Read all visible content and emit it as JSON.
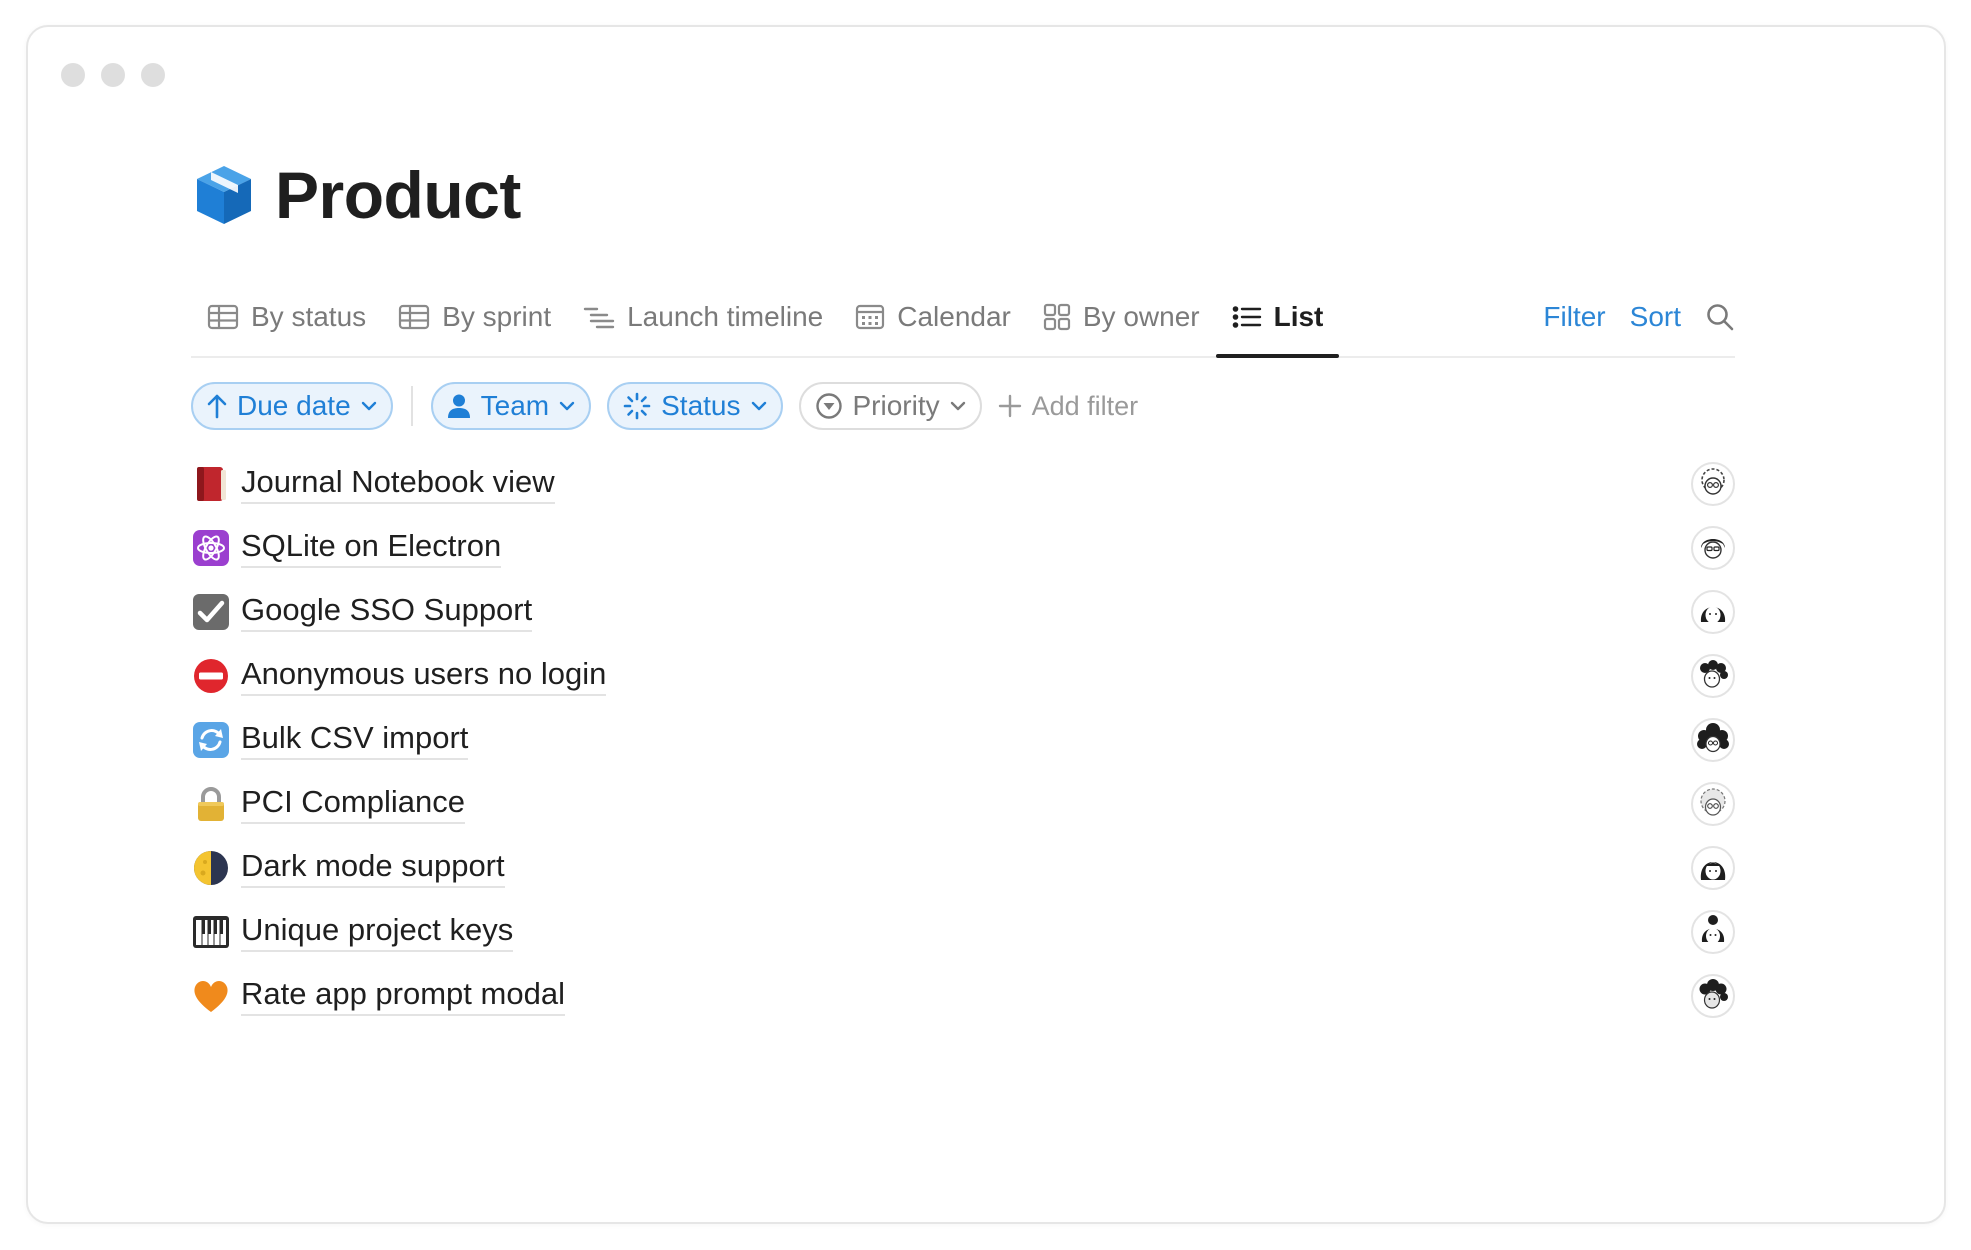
{
  "page": {
    "title": "Product",
    "icon": "package-cube-icon"
  },
  "tabs": [
    {
      "label": "By status",
      "icon": "table-icon",
      "active": false
    },
    {
      "label": "By sprint",
      "icon": "table-icon",
      "active": false
    },
    {
      "label": "Launch timeline",
      "icon": "timeline-icon",
      "active": false
    },
    {
      "label": "Calendar",
      "icon": "calendar-icon",
      "active": false
    },
    {
      "label": "By owner",
      "icon": "board-grid-icon",
      "active": false
    },
    {
      "label": "List",
      "icon": "list-icon",
      "active": true
    }
  ],
  "tab_actions": {
    "filter_label": "Filter",
    "sort_label": "Sort",
    "search_icon": "search-icon"
  },
  "filters": [
    {
      "label": "Due date",
      "icon": "arrow-up-icon",
      "active": true
    },
    {
      "label": "Team",
      "icon": "person-icon",
      "active": true
    },
    {
      "label": "Status",
      "icon": "status-spinner-icon",
      "active": true
    },
    {
      "label": "Priority",
      "icon": "priority-circle-icon",
      "active": false
    }
  ],
  "add_filter_label": "Add filter",
  "colors": {
    "accent_blue": "#2c86d6",
    "chip_border": "#a8cff2",
    "chip_bg": "#eaf3fc",
    "text_primary": "#1f1f1f",
    "text_muted": "#7a7a7a"
  },
  "items": [
    {
      "title": "Journal Notebook view",
      "icon": "red-book-icon",
      "owner_avatar": "avatar-glasses-curly"
    },
    {
      "title": "SQLite on Electron",
      "icon": "atom-symbol-icon",
      "owner_avatar": "avatar-dark-hair-glasses"
    },
    {
      "title": "Google SSO Support",
      "icon": "checkbox-checked-icon",
      "owner_avatar": "avatar-dark-hair"
    },
    {
      "title": "Anonymous users no login",
      "icon": "no-entry-icon",
      "owner_avatar": "avatar-curly-hair"
    },
    {
      "title": "Bulk CSV import",
      "icon": "refresh-arrows-icon",
      "owner_avatar": "avatar-dark-curly"
    },
    {
      "title": "PCI Compliance",
      "icon": "padlock-icon",
      "owner_avatar": "avatar-grey-glasses"
    },
    {
      "title": "Dark mode support",
      "icon": "half-moon-icon",
      "owner_avatar": "avatar-dark-hair-2"
    },
    {
      "title": "Unique project keys",
      "icon": "piano-keys-icon",
      "owner_avatar": "avatar-bun-hair"
    },
    {
      "title": "Rate app prompt modal",
      "icon": "orange-heart-icon",
      "owner_avatar": "avatar-curly-dark-2"
    }
  ]
}
